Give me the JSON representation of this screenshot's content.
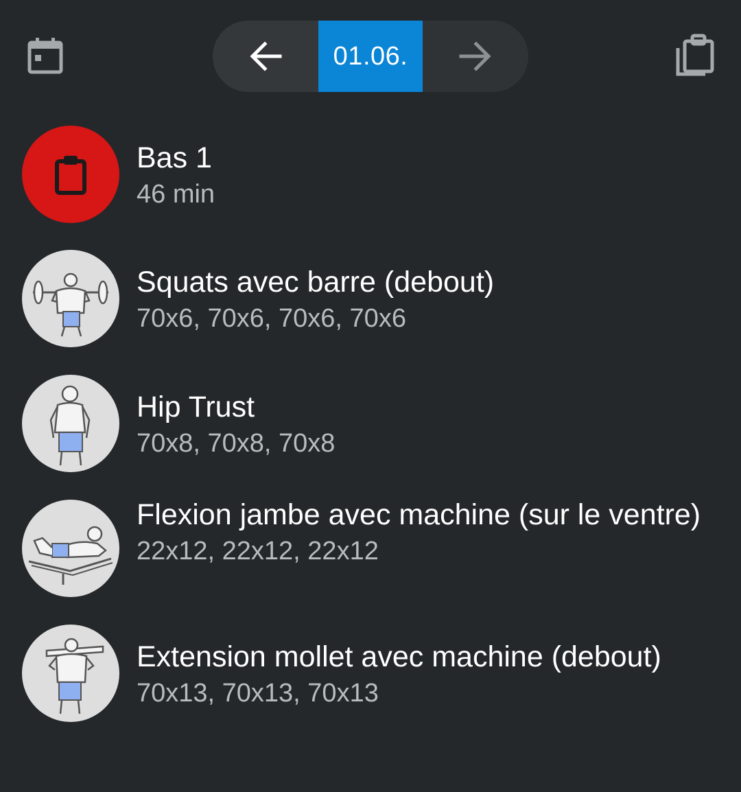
{
  "toolbar": {
    "calendar_icon": "calendar-icon",
    "prev_icon": "arrow-left-icon",
    "date": "01.06.",
    "next_icon": "arrow-right-icon",
    "clipboard_icon": "clipboard-copy-icon",
    "accent_color": "#0b85d6"
  },
  "session": {
    "title": "Bas 1",
    "duration": "46 min",
    "icon": "clipboard-icon",
    "color": "#d71616"
  },
  "exercises": [
    {
      "name": "Squats avec barre (debout)",
      "sets": "70x6, 70x6, 70x6, 70x6",
      "icon": "barbell-squat-icon"
    },
    {
      "name": "Hip Trust",
      "sets": "70x8, 70x8, 70x8",
      "icon": "hip-thrust-icon"
    },
    {
      "name": "Flexion jambe avec machine (sur le ventre)",
      "sets": "22x12, 22x12, 22x12",
      "icon": "lying-leg-curl-icon"
    },
    {
      "name": "Extension mollet avec machine (debout)",
      "sets": "70x13, 70x13, 70x13",
      "icon": "standing-calf-raise-icon"
    }
  ]
}
